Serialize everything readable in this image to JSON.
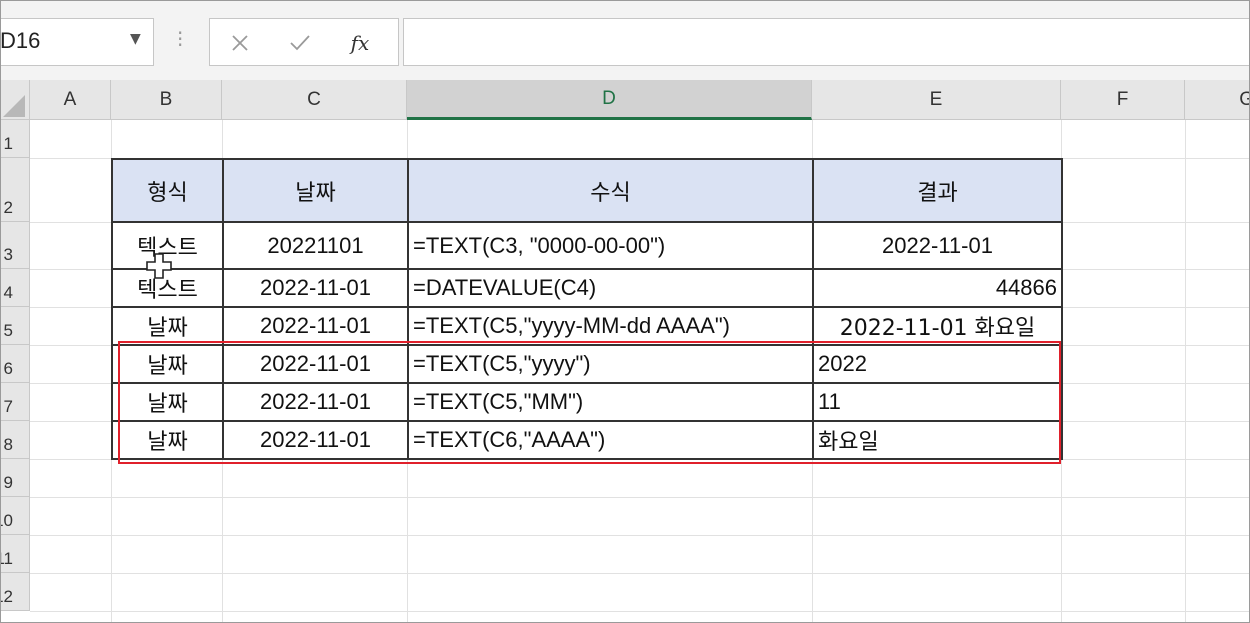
{
  "formula_bar": {
    "name_box": "D16",
    "fx_label": "fx",
    "formula": ""
  },
  "columns": [
    "A",
    "B",
    "C",
    "D",
    "E",
    "F",
    "G"
  ],
  "active_column": "D",
  "rows": [
    "1",
    "2",
    "3",
    "4",
    "5",
    "6",
    "7",
    "8",
    "9",
    "10",
    "11",
    "12"
  ],
  "table": {
    "headers": [
      "형식",
      "날짜",
      "수식",
      "결과"
    ],
    "rows": [
      [
        "텍스트",
        "20221101",
        "=TEXT(C3, \"0000-00-00\")",
        "2022-11-01"
      ],
      [
        "텍스트",
        "2022-11-01",
        "=DATEVALUE(C4)",
        "44866"
      ],
      [
        "날짜",
        "2022-11-01",
        "=TEXT(C5,\"yyyy-MM-dd AAAA\")",
        "2022-11-01 화요일"
      ],
      [
        "날짜",
        "2022-11-01",
        "=TEXT(C5,\"yyyy\")",
        "2022"
      ],
      [
        "날짜",
        "2022-11-01",
        "=TEXT(C5,\"MM\")",
        "11"
      ],
      [
        "날짜",
        "2022-11-01",
        "=TEXT(C6,\"AAAA\")",
        "화요일"
      ]
    ],
    "result_align": [
      "center",
      "right",
      "center",
      "left",
      "left",
      "left"
    ]
  },
  "colors": {
    "header_fill": "#dae2f3",
    "highlight": "#e0202b",
    "active_column": "#217346"
  },
  "icons": [
    "cancel-icon",
    "enter-icon",
    "fx-icon",
    "cell-select-cursor-icon",
    "dropdown-arrow-icon"
  ]
}
